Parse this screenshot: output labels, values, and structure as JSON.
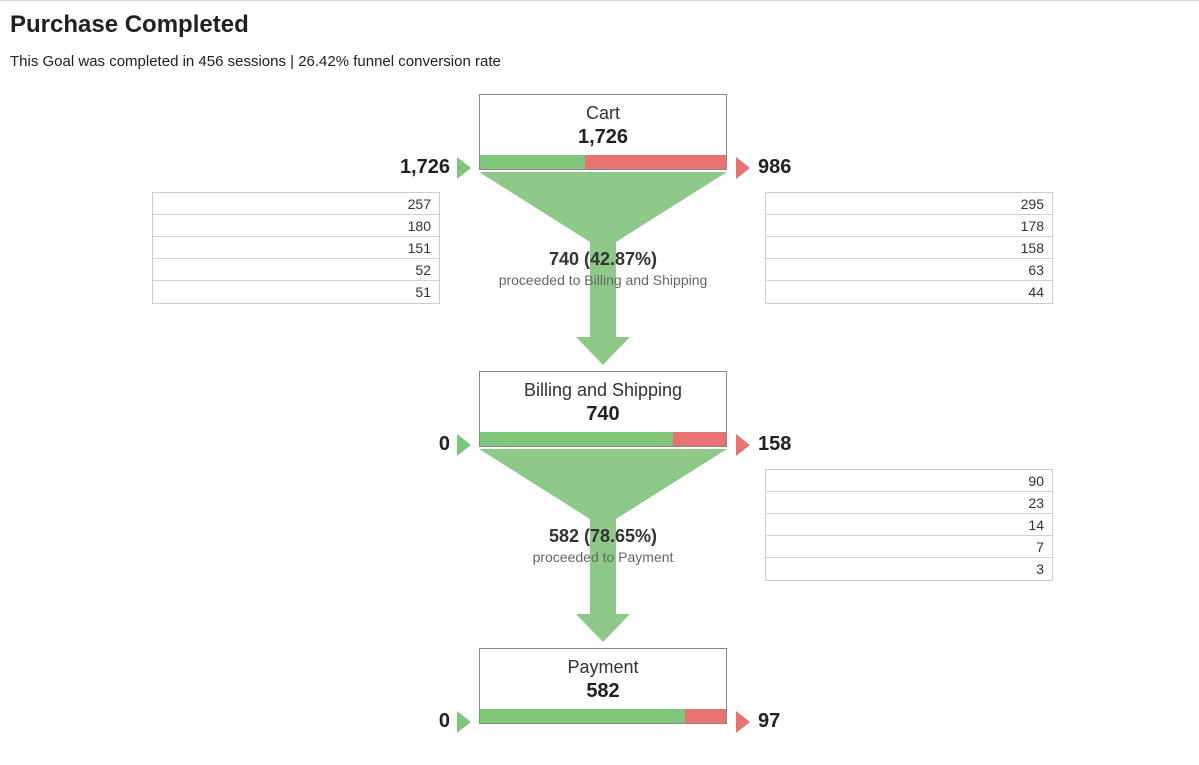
{
  "header": {
    "title": "Purchase Completed",
    "subtitle": "This Goal was completed in 456 sessions | 26.42% funnel conversion rate"
  },
  "stages": [
    {
      "name": "Cart",
      "value": "1,726",
      "in_count": "1,726",
      "out_count": "986",
      "proceed_pct": "740 (42.87%)",
      "proceed_desc": "proceeded to Billing and Shipping",
      "green_frac": 0.4287,
      "in_detail": [
        "257",
        "180",
        "151",
        "52",
        "51"
      ],
      "out_detail": [
        "295",
        "178",
        "158",
        "63",
        "44"
      ]
    },
    {
      "name": "Billing and Shipping",
      "value": "740",
      "in_count": "0",
      "out_count": "158",
      "proceed_pct": "582 (78.65%)",
      "proceed_desc": "proceeded to Payment",
      "green_frac": 0.7865,
      "in_detail": [],
      "out_detail": [
        "90",
        "23",
        "14",
        "7",
        "3"
      ]
    },
    {
      "name": "Payment",
      "value": "582",
      "in_count": "0",
      "out_count": "97",
      "proceed_pct": "",
      "proceed_desc": "",
      "green_frac": 0.833,
      "in_detail": [],
      "out_detail": []
    }
  ],
  "chart_data": {
    "type": "funnel",
    "title": "Purchase Completed",
    "goal_completions": 456,
    "funnel_conversion_rate": 0.2642,
    "stages": [
      {
        "name": "Cart",
        "sessions": 1726,
        "incoming": 1726,
        "dropoff": 986,
        "proceeded": 740,
        "proceed_rate": 0.4287,
        "next_stage": "Billing and Shipping",
        "incoming_breakdown": [
          257,
          180,
          151,
          52,
          51
        ],
        "dropoff_breakdown": [
          295,
          178,
          158,
          63,
          44
        ]
      },
      {
        "name": "Billing and Shipping",
        "sessions": 740,
        "incoming": 0,
        "dropoff": 158,
        "proceeded": 582,
        "proceed_rate": 0.7865,
        "next_stage": "Payment",
        "incoming_breakdown": [],
        "dropoff_breakdown": [
          90,
          23,
          14,
          7,
          3
        ]
      },
      {
        "name": "Payment",
        "sessions": 582,
        "incoming": 0,
        "dropoff": 97,
        "proceeded": null,
        "proceed_rate": null,
        "next_stage": null,
        "incoming_breakdown": [],
        "dropoff_breakdown": []
      }
    ]
  },
  "colors": {
    "green": "#80c67a",
    "red": "#e87373",
    "funnel": "#8fc98a"
  }
}
